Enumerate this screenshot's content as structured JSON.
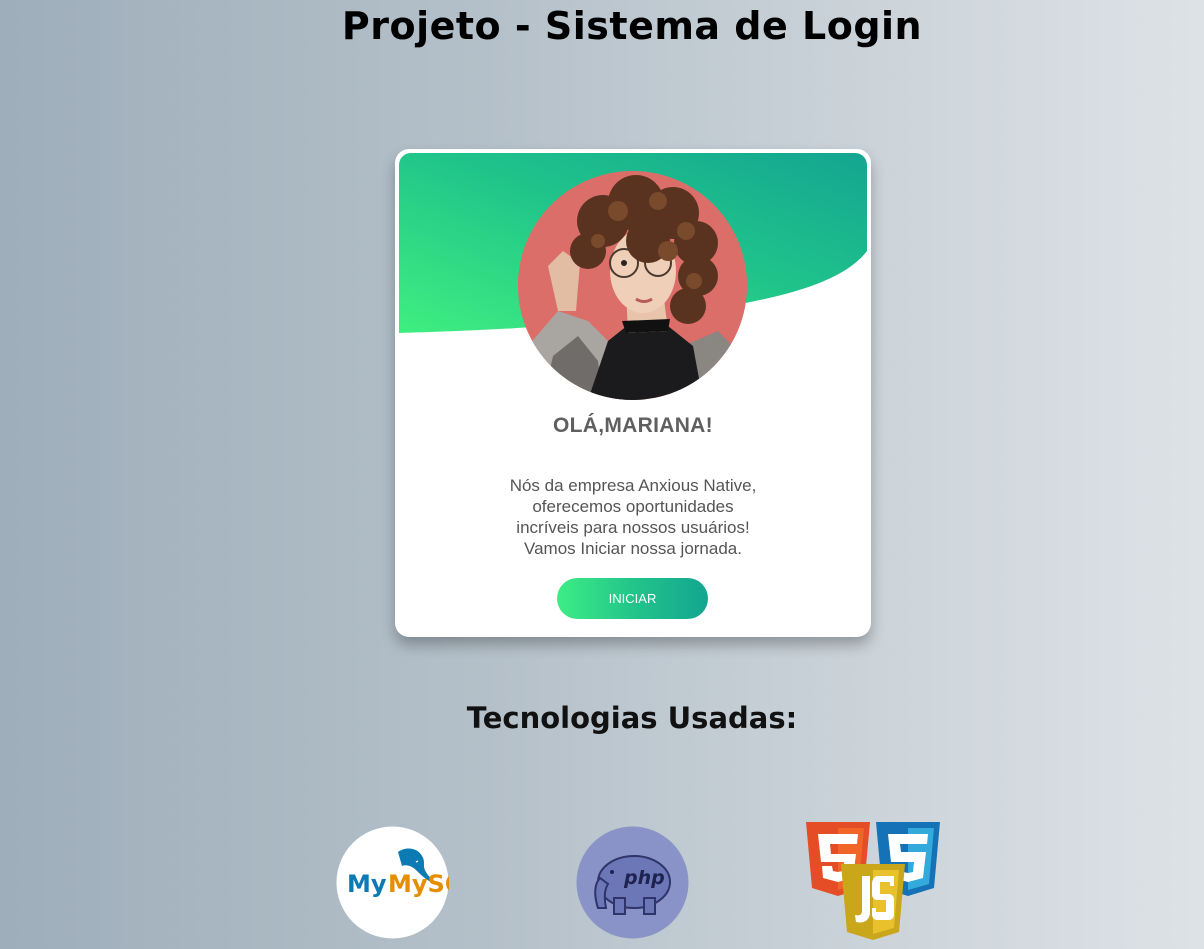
{
  "page": {
    "title": "Projeto - Sistema de Login"
  },
  "card": {
    "greeting": "OLÁ,MARIANA!",
    "message_lines": [
      "Nós da empresa Anxious Native,",
      "oferecemos oportunidades",
      "incríveis para nossos usuários!",
      "Vamos Iniciar nossa jornada."
    ],
    "button_label": "INICIAR",
    "accent_colors": [
      "#3ded85",
      "#13a591"
    ]
  },
  "technologies": {
    "heading": "Tecnologias Usadas:",
    "logos": [
      {
        "name": "MySQL",
        "label": "MySQL",
        "icon": "mysql-logo"
      },
      {
        "name": "PHP",
        "label": "php",
        "icon": "php-logo"
      },
      {
        "name": "HTML5 / CSS3 / JS",
        "icon": "html-css-js-logo"
      }
    ]
  }
}
